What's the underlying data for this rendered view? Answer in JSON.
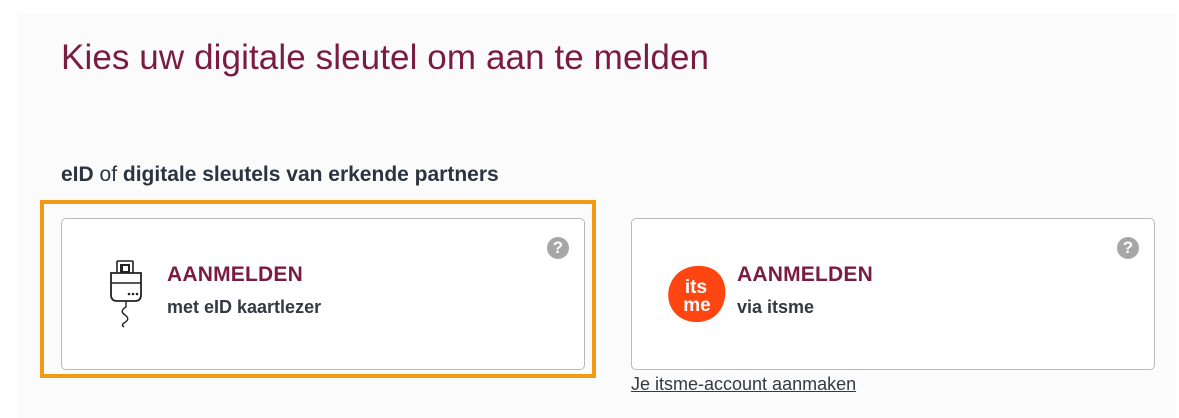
{
  "page": {
    "title": "Kies uw digitale sleutel om aan te melden"
  },
  "subheading": {
    "part1": "eID",
    "part2": " of ",
    "part3": "digitale sleutels van erkende partners"
  },
  "cards": {
    "eid": {
      "title": "AANMELDEN",
      "subtitle": "met eID kaartlezer",
      "help_symbol": "?",
      "icon": "card-reader-icon"
    },
    "itsme": {
      "title": "AANMELDEN",
      "subtitle": "via itsme",
      "help_symbol": "?",
      "icon": "itsme-logo",
      "logo_text_top": "its",
      "logo_text_bottom": "me"
    }
  },
  "links": {
    "create_itsme": "Je itsme-account aanmaken"
  },
  "colors": {
    "brand": "#7a1b41",
    "focus": "#f39a14",
    "itsme": "#ff4612",
    "help": "#a6a6a6"
  }
}
